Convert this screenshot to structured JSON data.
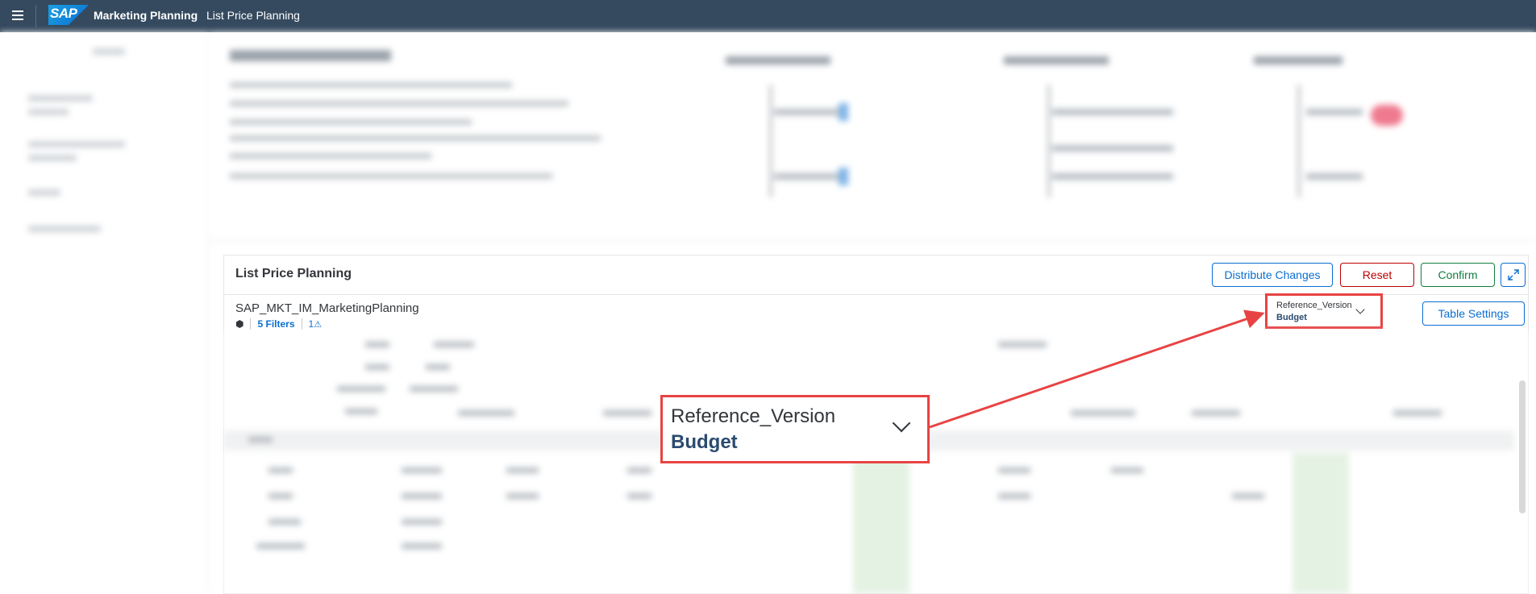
{
  "shell": {
    "app_title": "Marketing Planning",
    "page_title": "List Price Planning",
    "logo_text": "SAP",
    "menu_icon": "hamburger-menu-icon"
  },
  "card": {
    "title": "List Price Planning",
    "buttons": {
      "distribute": "Distribute Changes",
      "reset": "Reset",
      "confirm": "Confirm",
      "expand_icon": "expand-icon",
      "table_settings": "Table Settings"
    },
    "model": {
      "name": "SAP_MKT_IM_MarketingPlanning",
      "filters": "5 Filters",
      "warnings": "1",
      "model_icon": "cube-icon",
      "warning_icon": "warning-triangle-icon"
    },
    "reference_version": {
      "label": "Reference_Version",
      "value": "Budget"
    }
  },
  "callout": {
    "label": "Reference_Version",
    "value": "Budget"
  },
  "colors": {
    "shell_bg": "#354a5f",
    "accent": "#0a6ed1",
    "reset": "#bb0000",
    "confirm": "#107e3e",
    "highlight": "#e84343"
  }
}
